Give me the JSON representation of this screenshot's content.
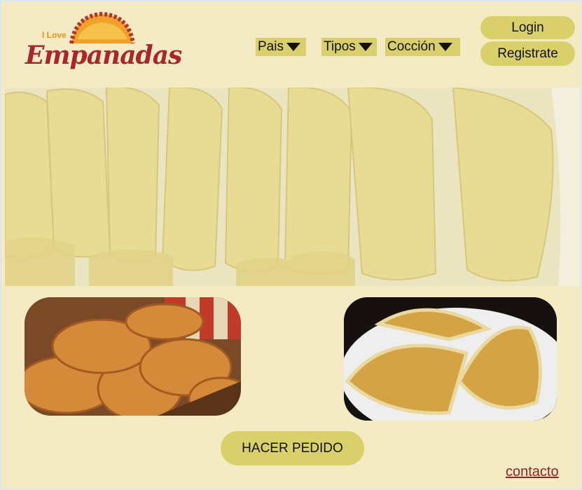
{
  "logo": {
    "small": "I Love",
    "big": "Empanadas"
  },
  "nav": {
    "pais": "Pais",
    "tipos": "Tipos",
    "coccion": "Cocción"
  },
  "auth": {
    "login": "Login",
    "register": "Registrate"
  },
  "order_button": "HACER PEDIDO",
  "contact_link": "contacto",
  "colors": {
    "background": "#f4eac3",
    "accent": "#d9cf6b",
    "brand_red": "#a8262e",
    "brand_orange": "#e8901e"
  },
  "icons": {
    "dropdown": "caret-down-icon"
  }
}
